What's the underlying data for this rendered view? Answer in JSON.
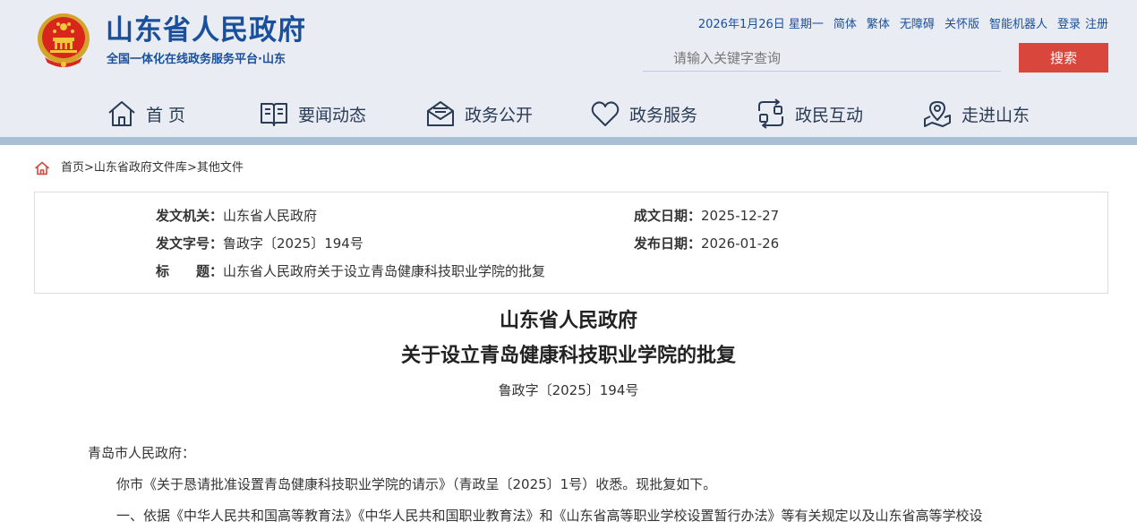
{
  "site": {
    "title": "山东省人民政府",
    "subtitle": "全国一体化在线政务服务平台·山东"
  },
  "toplinks": {
    "date": "2026年1月26日 星期一",
    "simplified": "简体",
    "traditional": "繁体",
    "accessible": "无障碍",
    "care": "关怀版",
    "robot": "智能机器人",
    "login": "登录",
    "register": "注册"
  },
  "search": {
    "placeholder": "请输入关键字查询",
    "button": "搜索"
  },
  "nav": [
    {
      "label": "首 页",
      "icon": "home-icon"
    },
    {
      "label": "要闻动态",
      "icon": "book-icon"
    },
    {
      "label": "政务公开",
      "icon": "mail-icon"
    },
    {
      "label": "政务服务",
      "icon": "heart-icon"
    },
    {
      "label": "政民互动",
      "icon": "exchange-icon"
    },
    {
      "label": "走进山东",
      "icon": "location-icon"
    }
  ],
  "breadcrumb": [
    "首页",
    "山东省政府文件库",
    "其他文件"
  ],
  "meta": {
    "issuer_label": "发文机关：",
    "issuer": "山东省人民政府",
    "docno_label": "发文字号：",
    "docno": "鲁政字〔2025〕194号",
    "subject_label": "标　　题：",
    "subject": "山东省人民政府关于设立青岛健康科技职业学院的批复",
    "written_label": "成文日期：",
    "written": "2025-12-27",
    "published_label": "发布日期：",
    "published": "2026-01-26"
  },
  "document": {
    "title_line1": "山东省人民政府",
    "title_line2": "关于设立青岛健康科技职业学院的批复",
    "number": "鲁政字〔2025〕194号",
    "salutation": "青岛市人民政府：",
    "para1": "你市《关于恳请批准设置青岛健康科技职业学院的请示》（青政呈〔2025〕1号）收悉。现批复如下。",
    "para2": "一、依据《中华人民共和国高等教育法》《中华人民共和国职业教育法》和《山东省高等职业学校设置暂行办法》等有关规定以及山东省高等学校设"
  },
  "colors": {
    "brand_blue": "#1a4f9c",
    "header_bg": "#e9edf3",
    "search_red": "#d9473c"
  }
}
